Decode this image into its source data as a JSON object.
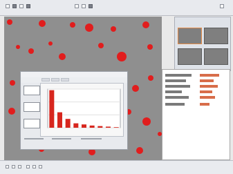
{
  "app": {
    "window": "image-analysis-workspace"
  },
  "icons": {
    "toolbar": [
      "image-icon",
      "camera-icon",
      "zoom-icon",
      "measure-icon",
      "grid-icon",
      "settings-icon",
      "layers-icon",
      "help-icon"
    ],
    "status": [
      "play-icon",
      "pause-icon",
      "stop-icon",
      "zoom-in-icon",
      "zoom-out-icon",
      "fit-icon"
    ]
  },
  "colors": {
    "background": "#e9e9e9",
    "canvas": "#8f8f8f",
    "highlight": "#e11d1d",
    "accent": "#e38a46"
  },
  "chart_data": {
    "type": "bar",
    "categories": [
      "",
      "",
      "",
      "",
      "",
      "",
      "",
      "",
      ""
    ],
    "values": [
      68,
      28,
      16,
      8,
      6,
      4,
      3,
      2,
      1
    ],
    "title": "",
    "xlabel": "",
    "ylabel": "",
    "ylim": [
      0,
      70
    ]
  }
}
